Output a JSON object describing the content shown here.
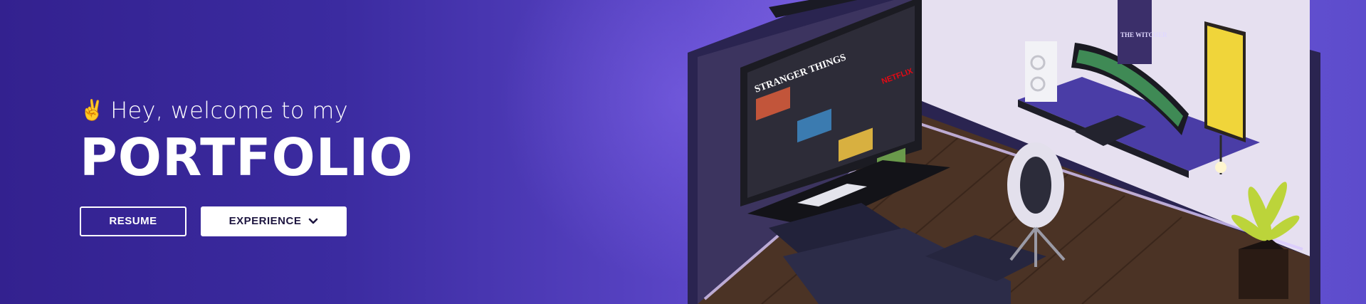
{
  "hero": {
    "greeting_emoji": "✌",
    "greeting": "Hey, welcome to my",
    "title": "PORTFOLIO"
  },
  "buttons": {
    "resume": "RESUME",
    "experience": "EXPERIENCE",
    "experience_icon": "chevron-down-icon"
  },
  "illustration": {
    "tv_title": "STRANGER THINGS",
    "tv_brand": "NETFLIX",
    "poster": "THE WITCHER"
  },
  "colors": {
    "bg_dark": "#33218f",
    "bg_light": "#7a60e0",
    "text": "#ffffff"
  }
}
